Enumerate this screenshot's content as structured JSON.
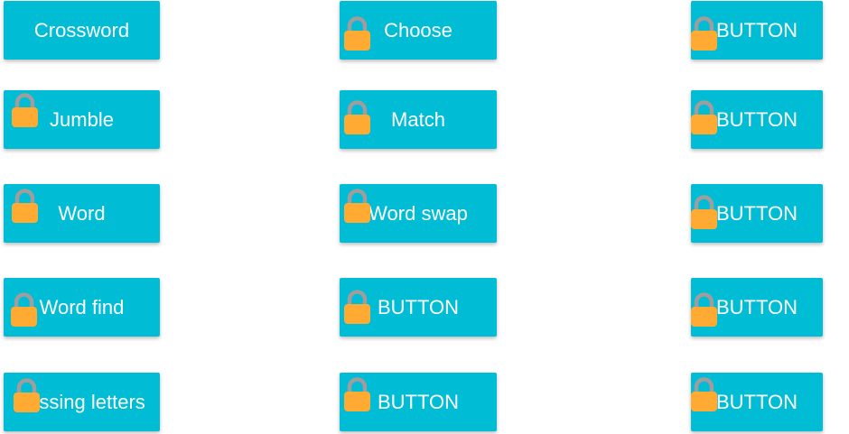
{
  "colors": {
    "button_bg": "#00bcd4",
    "button_text": "#ffffff",
    "lock_body": "#ffaa33",
    "lock_shackle": "#9e9e9e"
  },
  "buttons": [
    {
      "label": "Crossword",
      "locked": false
    },
    {
      "label": "Choose",
      "locked": true
    },
    {
      "label": "BUTTON",
      "locked": true
    },
    {
      "label": "Jumble",
      "locked": true
    },
    {
      "label": "Match",
      "locked": true
    },
    {
      "label": "BUTTON",
      "locked": true
    },
    {
      "label": "Word",
      "locked": true
    },
    {
      "label": "Word swap",
      "locked": true
    },
    {
      "label": "BUTTON",
      "locked": true
    },
    {
      "label": "Word find",
      "locked": true
    },
    {
      "label": "BUTTON",
      "locked": true
    },
    {
      "label": "BUTTON",
      "locked": true
    },
    {
      "label": "Missing letters",
      "locked": true
    },
    {
      "label": "BUTTON",
      "locked": true
    },
    {
      "label": "BUTTON",
      "locked": true
    }
  ],
  "lock_icon": "padlock-icon"
}
